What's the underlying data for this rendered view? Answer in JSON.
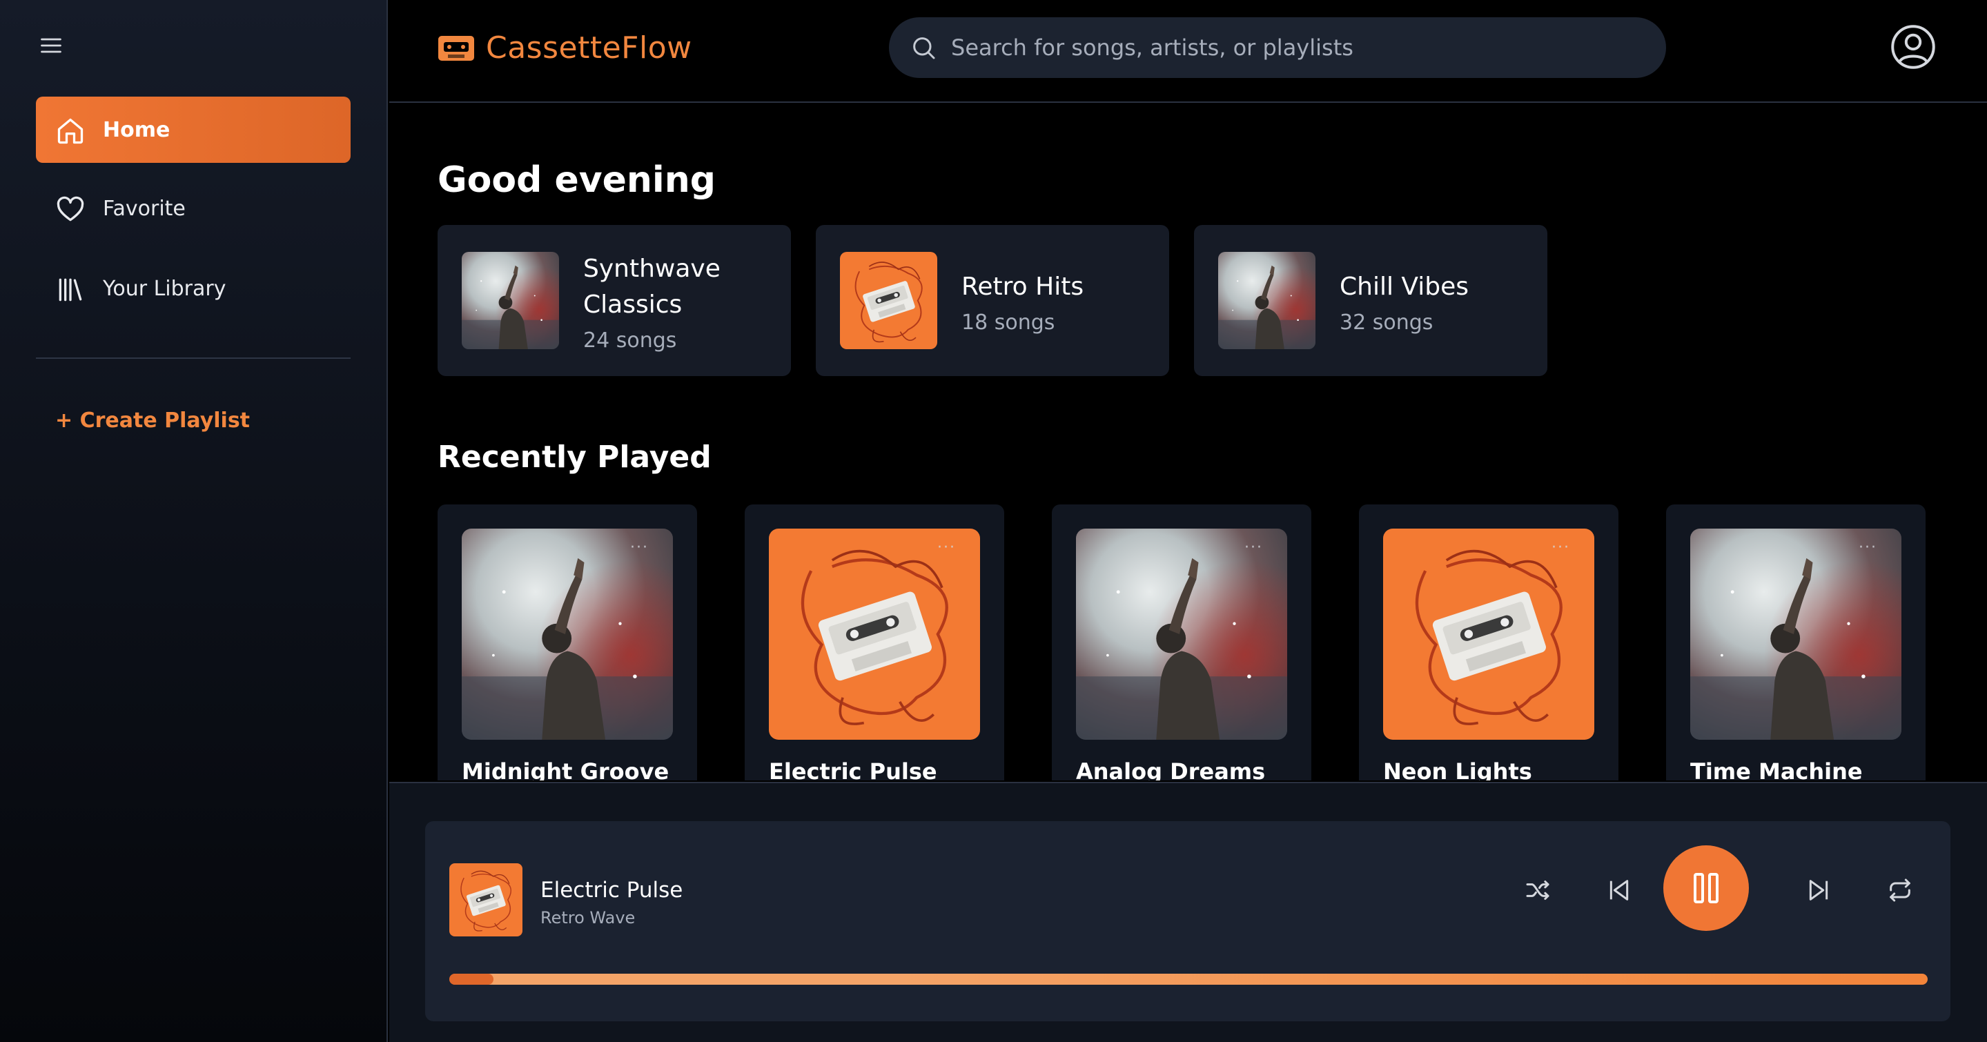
{
  "app": {
    "name": "CassetteFlow",
    "accent_color": "#f07634"
  },
  "sidebar": {
    "menu_icon": "hamburger-icon",
    "items": [
      {
        "label": "Home",
        "icon": "home-icon",
        "active": true
      },
      {
        "label": "Favorite",
        "icon": "heart-icon",
        "active": false
      },
      {
        "label": "Your Library",
        "icon": "library-icon",
        "active": false
      }
    ],
    "create_playlist": "+ Create Playlist"
  },
  "header": {
    "search": {
      "placeholder": "Search for songs, artists, or playlists",
      "value": ""
    },
    "user_icon": "user-circle-icon"
  },
  "main": {
    "greeting": "Good evening",
    "quick_playlists": [
      {
        "title_line1": "Synthwave",
        "title_line2": "Classics",
        "subtitle": "24 songs",
        "art": "concert"
      },
      {
        "title_line1": "Retro Hits",
        "subtitle": "18 songs",
        "art": "cassette"
      },
      {
        "title_line1": "Chill Vibes",
        "subtitle": "32 songs",
        "art": "concert"
      }
    ],
    "recently_played_title": "Recently Played",
    "recently_played": [
      {
        "title": "Midnight Groove",
        "art": "concert",
        "more": "···"
      },
      {
        "title": "Electric Pulse",
        "art": "cassette",
        "more": "···"
      },
      {
        "title": "Analog Dreams",
        "art": "concert",
        "more": "···"
      },
      {
        "title": "Neon Lights",
        "art": "cassette",
        "more": "···"
      },
      {
        "title": "Time Machine",
        "art": "concert",
        "more": "···"
      }
    ]
  },
  "player": {
    "title": "Electric Pulse",
    "artist": "Retro Wave",
    "art": "cassette",
    "state": "playing",
    "progress": 0.03,
    "controls": [
      "shuffle-icon",
      "skip-back-icon",
      "pause-icon",
      "skip-forward-icon",
      "repeat-icon"
    ]
  }
}
